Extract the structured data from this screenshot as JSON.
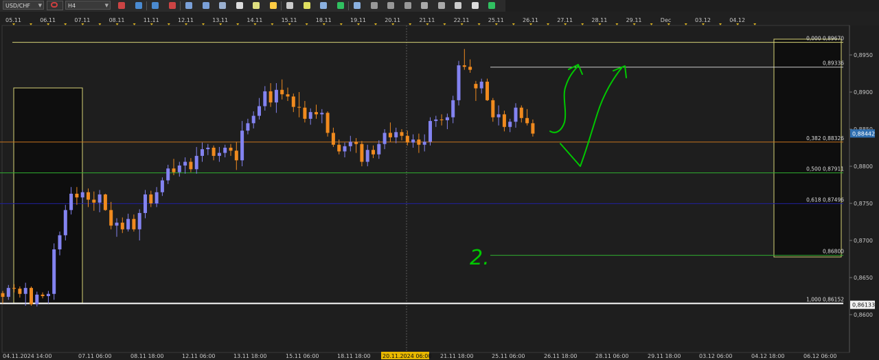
{
  "toolbar": {
    "symbol": "USD/CHF",
    "timeframe": "H4",
    "icons": [
      "chart-type-icon",
      "link-icon",
      "candles-icon",
      "bars-icon",
      "zoom-in-icon",
      "zoom-out-icon",
      "crosshair-icon",
      "cursor-icon",
      "text-icon",
      "indicators-icon",
      "color-icon",
      "draw-line-icon",
      "shapes-icon",
      "grid-icon",
      "layout-icon",
      "pointer-icon",
      "magic-icon",
      "window-icon",
      "ellipse-icon",
      "dots-icon",
      "pen-icon",
      "eraser-icon",
      "more-icon"
    ]
  },
  "colors": {
    "background": "#1e1e1e",
    "bull": "#8383f0",
    "bear": "#f08a1e",
    "fib_frame": "#d8d478",
    "level_0": "#d8d478",
    "level_382": "#c8741e",
    "level_500": "#30b030",
    "level_618": "#2020a0",
    "level_1000": "#ffffff",
    "annotation": "#00c800",
    "price_tag_current": "#2f6fb0"
  },
  "chart_data": {
    "type": "candlestick",
    "symbol": "USD/CHF",
    "timeframe": "H4",
    "ylim": [
      0.8595,
      0.8978
    ],
    "y_ticks": [
      "0,8950",
      "0,8900",
      "0,8850",
      "0,8800",
      "0,8750",
      "0,8700",
      "0,8650",
      "0,8600"
    ],
    "y_tick_values": [
      0.895,
      0.89,
      0.885,
      0.88,
      0.875,
      0.87,
      0.865,
      0.86
    ],
    "top_date_labels": [
      "05.11",
      "06.11",
      "07.11",
      "08.11",
      "11.11",
      "12.11",
      "13.11",
      "14.11",
      "15.11",
      "18.11",
      "19.11",
      "20.11",
      "21.11",
      "22.11",
      "25.11",
      "26.11",
      "27.11",
      "28.11",
      "29.11",
      "Dec",
      "03.12",
      "04.12"
    ],
    "bottom_time_labels": [
      "04.11.2024 14:00",
      "07.11 06:00",
      "08.11 18:00",
      "12.11 06:00",
      "13.11 18:00",
      "15.11 06:00",
      "18.11 18:00",
      "20.11.2024 06:00",
      "21.11 18:00",
      "25.11 06:00",
      "26.11 18:00",
      "28.11 06:00",
      "29.11 18:00",
      "03.12 06:00",
      "04.12 18:00",
      "06.12 06:00"
    ],
    "crosshair_time": "20.11.2024 06:00",
    "current_price": "0,88442",
    "current_price_value": 0.88442,
    "fib_levels": [
      {
        "label": "0,000 0,89670",
        "value": 0.8967,
        "color": "#d8d478"
      },
      {
        "label": "0,89336",
        "value": 0.89336,
        "color": "#cccccc"
      },
      {
        "label": "0,382 0,88326",
        "value": 0.88326,
        "color": "#c8741e"
      },
      {
        "label": "0,500 0,87911",
        "value": 0.87911,
        "color": "#30b030"
      },
      {
        "label": "0,618 0,87496",
        "value": 0.87496,
        "color": "#2020a0"
      },
      {
        "label": "0,86800",
        "value": 0.868,
        "color": "#30b030"
      },
      {
        "label": "1,000 0,86152",
        "value": 0.86152,
        "color": "#ffffff"
      }
    ],
    "low_price_tag": "0,86133",
    "low_price_value": 0.86133,
    "annotation_text": "2.",
    "candles": [
      [
        0.8629,
        0.8632,
        0.8615,
        0.8624
      ],
      [
        0.8624,
        0.864,
        0.862,
        0.8636
      ],
      [
        0.8636,
        0.8641,
        0.863,
        0.8635
      ],
      [
        0.8635,
        0.8638,
        0.8623,
        0.8628
      ],
      [
        0.8628,
        0.8643,
        0.8612,
        0.8636
      ],
      [
        0.8636,
        0.8638,
        0.8612,
        0.8614
      ],
      [
        0.8614,
        0.8631,
        0.8611,
        0.8627
      ],
      [
        0.8627,
        0.863,
        0.8622,
        0.8625
      ],
      [
        0.8625,
        0.8632,
        0.8615,
        0.8628
      ],
      [
        0.8628,
        0.8696,
        0.862,
        0.8688
      ],
      [
        0.8688,
        0.8712,
        0.868,
        0.8707
      ],
      [
        0.8707,
        0.8748,
        0.87,
        0.8741
      ],
      [
        0.8741,
        0.8772,
        0.8735,
        0.8763
      ],
      [
        0.8763,
        0.8772,
        0.8748,
        0.8758
      ],
      [
        0.8758,
        0.8768,
        0.875,
        0.8765
      ],
      [
        0.8765,
        0.877,
        0.8745,
        0.8755
      ],
      [
        0.8755,
        0.8766,
        0.874,
        0.8751
      ],
      [
        0.8751,
        0.8768,
        0.8738,
        0.8762
      ],
      [
        0.8762,
        0.8763,
        0.874,
        0.8741
      ],
      [
        0.8741,
        0.8752,
        0.8715,
        0.872
      ],
      [
        0.872,
        0.873,
        0.8705,
        0.8724
      ],
      [
        0.8724,
        0.8731,
        0.871,
        0.8715
      ],
      [
        0.8715,
        0.8736,
        0.8712,
        0.8729
      ],
      [
        0.8729,
        0.8735,
        0.8712,
        0.8715
      ],
      [
        0.8715,
        0.8742,
        0.87,
        0.8737
      ],
      [
        0.8737,
        0.8768,
        0.873,
        0.8762
      ],
      [
        0.8762,
        0.8767,
        0.8745,
        0.875
      ],
      [
        0.875,
        0.8772,
        0.8745,
        0.8765
      ],
      [
        0.8765,
        0.8785,
        0.876,
        0.8781
      ],
      [
        0.8781,
        0.8802,
        0.8776,
        0.8797
      ],
      [
        0.8797,
        0.881,
        0.8788,
        0.8792
      ],
      [
        0.8792,
        0.8806,
        0.8786,
        0.8801
      ],
      [
        0.8801,
        0.8812,
        0.879,
        0.8806
      ],
      [
        0.8806,
        0.8811,
        0.8792,
        0.8796
      ],
      [
        0.8796,
        0.8826,
        0.879,
        0.8814
      ],
      [
        0.8814,
        0.8832,
        0.8806,
        0.8823
      ],
      [
        0.8823,
        0.883,
        0.8815,
        0.8825
      ],
      [
        0.8825,
        0.8828,
        0.8808,
        0.8814
      ],
      [
        0.8814,
        0.8826,
        0.8806,
        0.8818
      ],
      [
        0.8818,
        0.8829,
        0.8812,
        0.8825
      ],
      [
        0.8825,
        0.883,
        0.8814,
        0.8821
      ],
      [
        0.8821,
        0.8833,
        0.8795,
        0.8808
      ],
      [
        0.8808,
        0.8861,
        0.88,
        0.8848
      ],
      [
        0.8848,
        0.8864,
        0.8843,
        0.8858
      ],
      [
        0.8858,
        0.8874,
        0.8851,
        0.8868
      ],
      [
        0.8868,
        0.8892,
        0.8863,
        0.8881
      ],
      [
        0.8881,
        0.8908,
        0.8875,
        0.8901
      ],
      [
        0.8901,
        0.8912,
        0.888,
        0.8886
      ],
      [
        0.8886,
        0.8912,
        0.8872,
        0.8903
      ],
      [
        0.8903,
        0.8917,
        0.889,
        0.8897
      ],
      [
        0.8897,
        0.8906,
        0.8888,
        0.8894
      ],
      [
        0.8894,
        0.8898,
        0.8873,
        0.888
      ],
      [
        0.888,
        0.89,
        0.8866,
        0.8879
      ],
      [
        0.8879,
        0.8888,
        0.8859,
        0.8864
      ],
      [
        0.8864,
        0.8878,
        0.8856,
        0.8873
      ],
      [
        0.8873,
        0.8883,
        0.8864,
        0.887
      ],
      [
        0.887,
        0.8877,
        0.8858,
        0.8872
      ],
      [
        0.8872,
        0.8874,
        0.884,
        0.8845
      ],
      [
        0.8845,
        0.8852,
        0.8826,
        0.8829
      ],
      [
        0.8829,
        0.8836,
        0.8816,
        0.882
      ],
      [
        0.882,
        0.8832,
        0.8812,
        0.8827
      ],
      [
        0.8827,
        0.8841,
        0.882,
        0.8833
      ],
      [
        0.8833,
        0.8838,
        0.8818,
        0.883
      ],
      [
        0.883,
        0.8834,
        0.88,
        0.8806
      ],
      [
        0.8806,
        0.8829,
        0.88,
        0.8822
      ],
      [
        0.8822,
        0.8828,
        0.8811,
        0.8816
      ],
      [
        0.8816,
        0.8835,
        0.881,
        0.883
      ],
      [
        0.883,
        0.885,
        0.8823,
        0.8845
      ],
      [
        0.8845,
        0.8859,
        0.8833,
        0.8839
      ],
      [
        0.8839,
        0.8852,
        0.8831,
        0.8846
      ],
      [
        0.8846,
        0.885,
        0.8835,
        0.8841
      ],
      [
        0.8841,
        0.8848,
        0.8828,
        0.8832
      ],
      [
        0.8832,
        0.8843,
        0.8825,
        0.8836
      ],
      [
        0.8836,
        0.8844,
        0.8818,
        0.8829
      ],
      [
        0.8829,
        0.8843,
        0.882,
        0.8833
      ],
      [
        0.8833,
        0.8866,
        0.8828,
        0.8861
      ],
      [
        0.8861,
        0.8868,
        0.8853,
        0.8863
      ],
      [
        0.8863,
        0.887,
        0.8855,
        0.8862
      ],
      [
        0.8862,
        0.8871,
        0.885,
        0.8866
      ],
      [
        0.8866,
        0.8895,
        0.8858,
        0.8889
      ],
      [
        0.8889,
        0.8942,
        0.8882,
        0.8936
      ],
      [
        0.8936,
        0.8958,
        0.893,
        0.8934
      ],
      [
        0.8934,
        0.8944,
        0.8926,
        0.893
      ],
      [
        0.8911,
        0.8915,
        0.8888,
        0.8905
      ],
      [
        0.8905,
        0.8918,
        0.8898,
        0.8914
      ],
      [
        0.8914,
        0.8918,
        0.8888,
        0.8889
      ],
      [
        0.8889,
        0.8892,
        0.886,
        0.8866
      ],
      [
        0.8866,
        0.8882,
        0.8855,
        0.887
      ],
      [
        0.887,
        0.8875,
        0.8847,
        0.8853
      ],
      [
        0.8853,
        0.8864,
        0.8846,
        0.886
      ],
      [
        0.886,
        0.8885,
        0.8852,
        0.8879
      ],
      [
        0.8879,
        0.8882,
        0.8859,
        0.8865
      ],
      [
        0.8865,
        0.8877,
        0.8855,
        0.8858
      ],
      [
        0.8858,
        0.8863,
        0.884,
        0.8844
      ]
    ]
  }
}
